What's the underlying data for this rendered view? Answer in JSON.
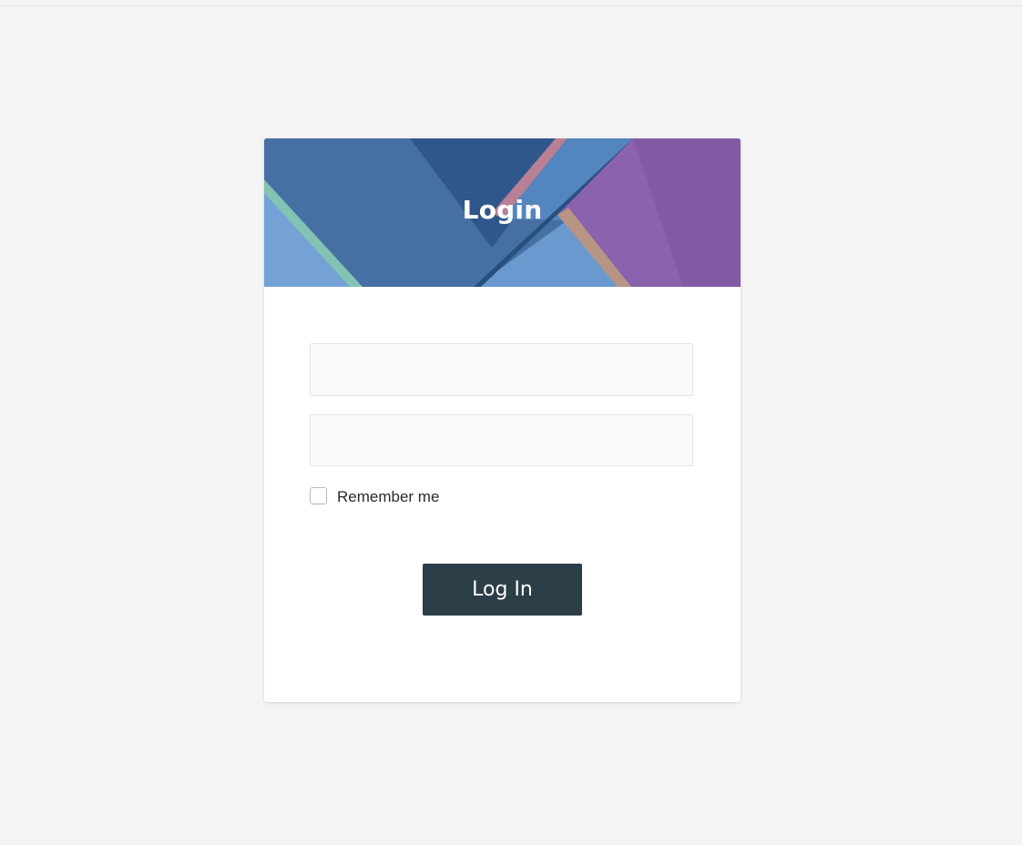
{
  "login_card": {
    "title": "Login",
    "username_field": {
      "value": "",
      "placeholder": ""
    },
    "password_field": {
      "value": "",
      "placeholder": ""
    },
    "remember_me": {
      "label": "Remember me",
      "checked": false
    },
    "submit_label": "Log In"
  },
  "colors": {
    "page_background": "#f4f4f4",
    "card_background": "#ffffff",
    "banner_blue": "#4670a3",
    "banner_purple": "#8b62ad",
    "button_background": "#2c3e48",
    "button_text": "#ffffff"
  }
}
